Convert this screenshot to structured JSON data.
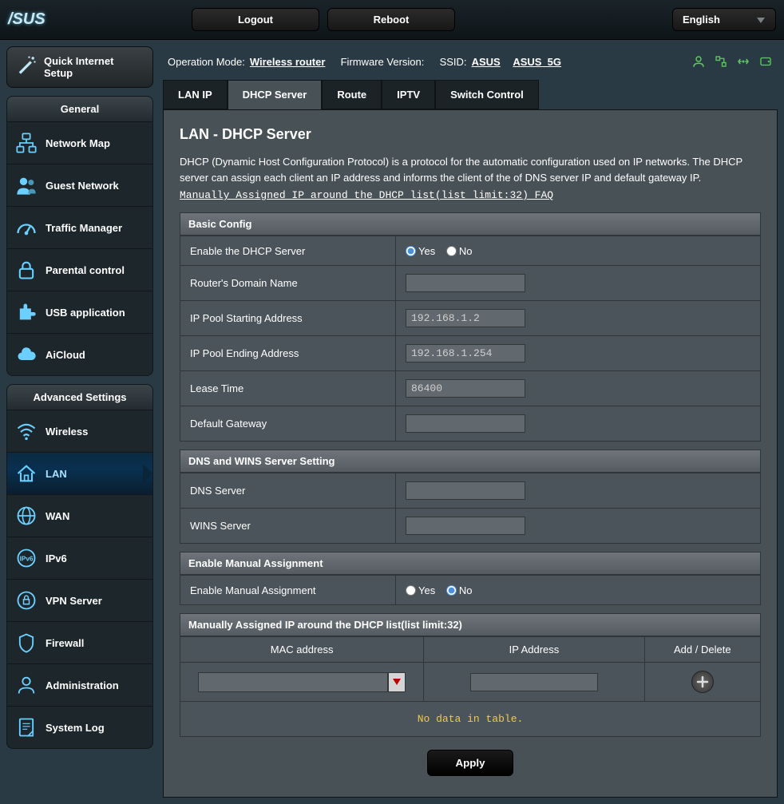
{
  "brand": "/SUS",
  "top": {
    "logout": "Logout",
    "reboot": "Reboot",
    "language": "English"
  },
  "info": {
    "op_mode_label": "Operation Mode:",
    "op_mode_value": "Wireless router",
    "fw_label": "Firmware Version:",
    "ssid_label": "SSID:",
    "ssid1": "ASUS",
    "ssid2": "ASUS_5G"
  },
  "sidebar": {
    "quick": "Quick Internet Setup",
    "general_head": "General",
    "general": [
      "Network Map",
      "Guest Network",
      "Traffic Manager",
      "Parental control",
      "USB application",
      "AiCloud"
    ],
    "adv_head": "Advanced Settings",
    "adv": [
      "Wireless",
      "LAN",
      "WAN",
      "IPv6",
      "VPN Server",
      "Firewall",
      "Administration",
      "System Log"
    ]
  },
  "tabs": [
    "LAN IP",
    "DHCP Server",
    "Route",
    "IPTV",
    "Switch Control"
  ],
  "page": {
    "title": "LAN - DHCP Server",
    "desc": "DHCP (Dynamic Host Configuration Protocol) is a protocol for the automatic configuration used on IP networks. The DHCP server can assign each client an IP address and informs the client of the of DNS server IP and default gateway IP.",
    "faq": "Manually Assigned IP around the DHCP list(list limit:32) FAQ"
  },
  "basic": {
    "head": "Basic Config",
    "enable_label": "Enable the DHCP Server",
    "yes": "Yes",
    "no": "No",
    "domain_label": "Router's Domain Name",
    "domain_val": "",
    "pool_start_label": "IP Pool Starting Address",
    "pool_start_val": "192.168.1.2",
    "pool_end_label": "IP Pool Ending Address",
    "pool_end_val": "192.168.1.254",
    "lease_label": "Lease Time",
    "lease_val": "86400",
    "gw_label": "Default Gateway",
    "gw_val": ""
  },
  "dns": {
    "head": "DNS and WINS Server Setting",
    "dns_label": "DNS Server",
    "dns_val": "",
    "wins_label": "WINS Server",
    "wins_val": ""
  },
  "manual": {
    "head": "Enable Manual Assignment",
    "label": "Enable Manual Assignment"
  },
  "mactable": {
    "head": "Manually Assigned IP around the DHCP list(list limit:32)",
    "col_mac": "MAC address",
    "col_ip": "IP Address",
    "col_add": "Add / Delete",
    "nodata": "No data in table."
  },
  "apply": "Apply"
}
